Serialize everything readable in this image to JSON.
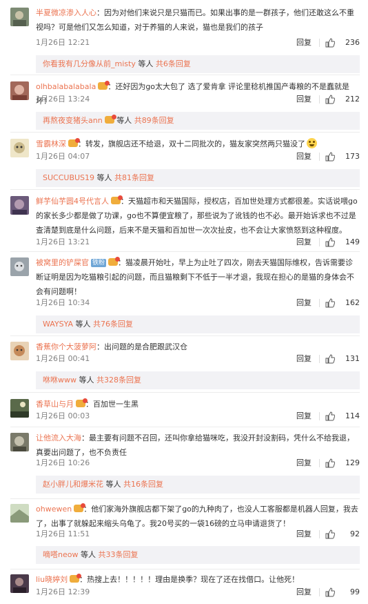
{
  "colors": {
    "username": "#eb7350",
    "meta": "#808080",
    "subbox": "#f2f2f5",
    "vip": "#f0ad3c",
    "text": "#333333"
  },
  "common": {
    "reply": "回复",
    "deng": "等人",
    "gong": "共",
    "tiao": "条回复"
  },
  "comments": [
    {
      "user": "半夏微凉渗入人心",
      "vip": false,
      "badge": "",
      "text": "：因为对他们来说只是只猫而已。如果出事的是一群孩子，他们还敢这么不重视吗？可是他们又怎么知道，对于养猫的人来说，猫也是我们的孩子",
      "emoji": false,
      "time": "1月26日 12:21",
      "likes": "236",
      "sub_user": "你看我有几分像从前_misty",
      "sub_vip": false,
      "sub_count": "6",
      "avatar": "#7d8b74"
    },
    {
      "user": "olhbalabalabala",
      "vip": true,
      "badge": "",
      "text": "：还好因为go太大包了 选了爱肯拿 评论里稔机推国产毒粮的不是蠢就是坏！",
      "emoji": false,
      "time": "1月26日 13:24",
      "likes": "212",
      "sub_user": "再熬夜变猪头ann",
      "sub_vip": true,
      "sub_count": "89",
      "avatar": "#a2685a"
    },
    {
      "user": "雪霸林深",
      "vip": true,
      "badge": "",
      "text": "：转发，旗舰店还不给退，双十二同批次的，猫友家突然两只猫没了",
      "emoji": true,
      "time": "1月26日 04:07",
      "likes": "173",
      "sub_user": "SUCCUBUS19",
      "sub_vip": false,
      "sub_count": "81",
      "avatar": "#c9b98b"
    },
    {
      "user": "鲜芋仙芋圆4号代言人",
      "vip": true,
      "badge": "",
      "text": "：天猫超市和天猫国际，授权店，百加世处理方式都很差。实话说喂go的家长多少都是做了功课，go也不算便宜粮了，那些说为了讹钱的也不必。最开始诉求也不过是查清楚到底是什么问题，后来不是天猫和百加世一次次扯皮，也不会让大家愤怒到这种程度。",
      "emoji": false,
      "time": "1月26日 13:21",
      "likes": "149",
      "sub_user": "",
      "sub_vip": false,
      "sub_count": "",
      "avatar": "#6b5a7a"
    },
    {
      "user": "被窝里的铲屎官",
      "vip": true,
      "badge": "铁粉",
      "text": "：猫凌晨开始吐，早上为止吐了四次，刚去天猫国际维权，告诉需要诊断证明是因为吃猫粮引起的问题，而且猫粮剩下不低于一半才退，我现在担心的是猫的身体会不会有问题啊！",
      "emoji": false,
      "time": "1月26日 10:34",
      "likes": "162",
      "sub_user": "WAYSYA",
      "sub_vip": false,
      "sub_count": "76",
      "avatar": "#9aa3aa"
    },
    {
      "user": "香蕉你个大菠萝阿",
      "vip": false,
      "badge": "",
      "text": "：出问题的是合肥跟武汉仓",
      "emoji": false,
      "time": "1月26日 00:41",
      "likes": "131",
      "sub_user": "咻咻www",
      "sub_vip": false,
      "sub_count": "328",
      "avatar": "#c58a5a"
    },
    {
      "user": "香草山与月",
      "vip": true,
      "badge": "",
      "text": "：百加世一生黑",
      "emoji": false,
      "time": "1月26日 00:03",
      "likes": "114",
      "sub_user": "",
      "sub_vip": false,
      "sub_count": "",
      "avatar": "#5a6a4a"
    },
    {
      "user": "让他流入大海",
      "vip": false,
      "badge": "",
      "text": "：最主要有问题不召回，还叫你拿给猫咪吃，我没开封没割码，凭什么不给我退，真要出问题了，也不负责任",
      "emoji": false,
      "time": "1月26日 10:26",
      "likes": "129",
      "sub_user": "赵小胖儿和爆米花",
      "sub_vip": false,
      "sub_count": "16",
      "avatar": "#7a7a6a"
    },
    {
      "user": "ohwewen",
      "vip": true,
      "badge": "",
      "text": "：他们家海外旗舰店都下架了go的九种肉了，也没人工客服都是机器人回复，我去了，出事了就躲起来缩头乌龟了。我20号买的一袋16磅的立马申请退货了！",
      "emoji": false,
      "time": "1月26日 11:51",
      "likes": "92",
      "sub_user": "嘀嗒neow",
      "sub_vip": false,
      "sub_count": "33",
      "avatar": "#8a9a7a"
    },
    {
      "user": "liu晓婷刘",
      "vip": true,
      "badge": "",
      "text": "：热搜上去！！！！！理由是换季？现在了还在找借口。让他死！",
      "emoji": false,
      "time": "1月26日 12:39",
      "likes": "99",
      "sub_user": "",
      "sub_vip": false,
      "sub_count": "",
      "avatar": "#4a3a4a"
    }
  ]
}
